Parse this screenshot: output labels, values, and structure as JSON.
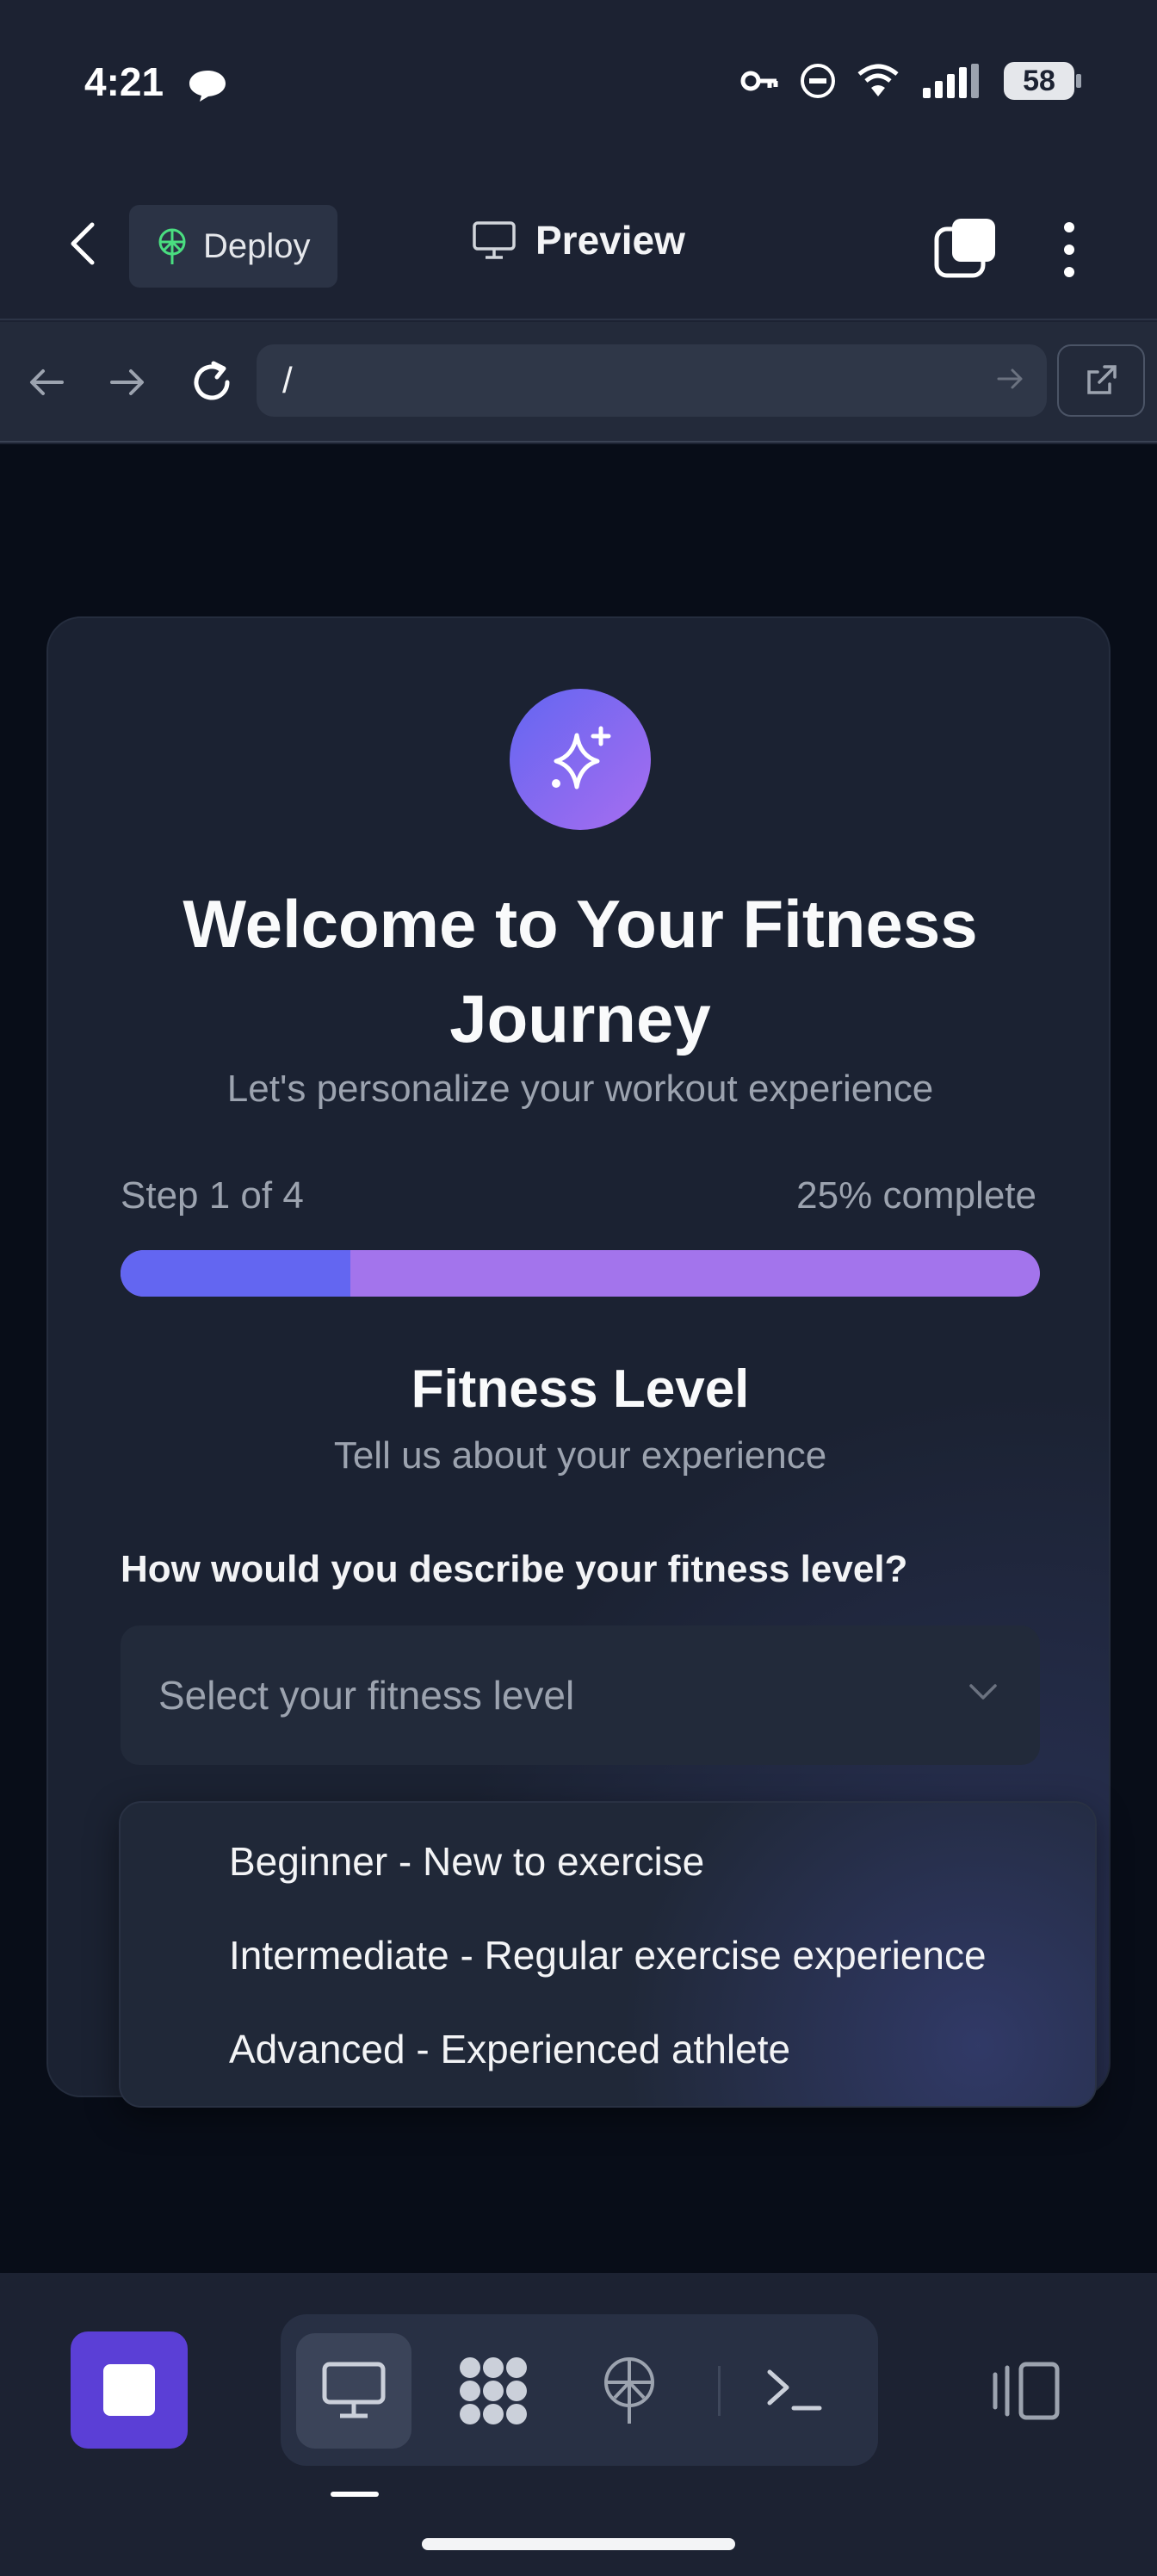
{
  "status_bar": {
    "time": "4:21",
    "battery": "58",
    "icons": [
      "chat-bubble-icon",
      "key-icon",
      "do-not-disturb-icon",
      "wifi-icon",
      "signal-icon",
      "battery-icon"
    ]
  },
  "header": {
    "deploy_label": "Deploy",
    "title": "Preview"
  },
  "browser": {
    "url": "/"
  },
  "onboarding": {
    "title": "Welcome to Your Fitness Journey",
    "subtitle": "Let's personalize your workout experience",
    "step_label": "Step 1 of 4",
    "percent_label": "25% complete",
    "progress": 0.25,
    "section_title": "Fitness Level",
    "section_subtitle": "Tell us about your experience",
    "question": "How would you describe your fitness level?",
    "select_placeholder": "Select your fitness level",
    "options": [
      "Beginner - New to exercise",
      "Intermediate - Regular exercise experience",
      "Advanced - Experienced athlete"
    ]
  },
  "colors": {
    "accent": "#6366f1",
    "accent_purple": "#a374ec",
    "stop_button": "#5b3fd6",
    "deploy_icon": "#4ade80"
  },
  "toolbar": {
    "tools": [
      "monitor-icon",
      "apps-icon",
      "deploy-icon",
      "terminal-icon"
    ],
    "active_tool": "monitor-icon"
  }
}
